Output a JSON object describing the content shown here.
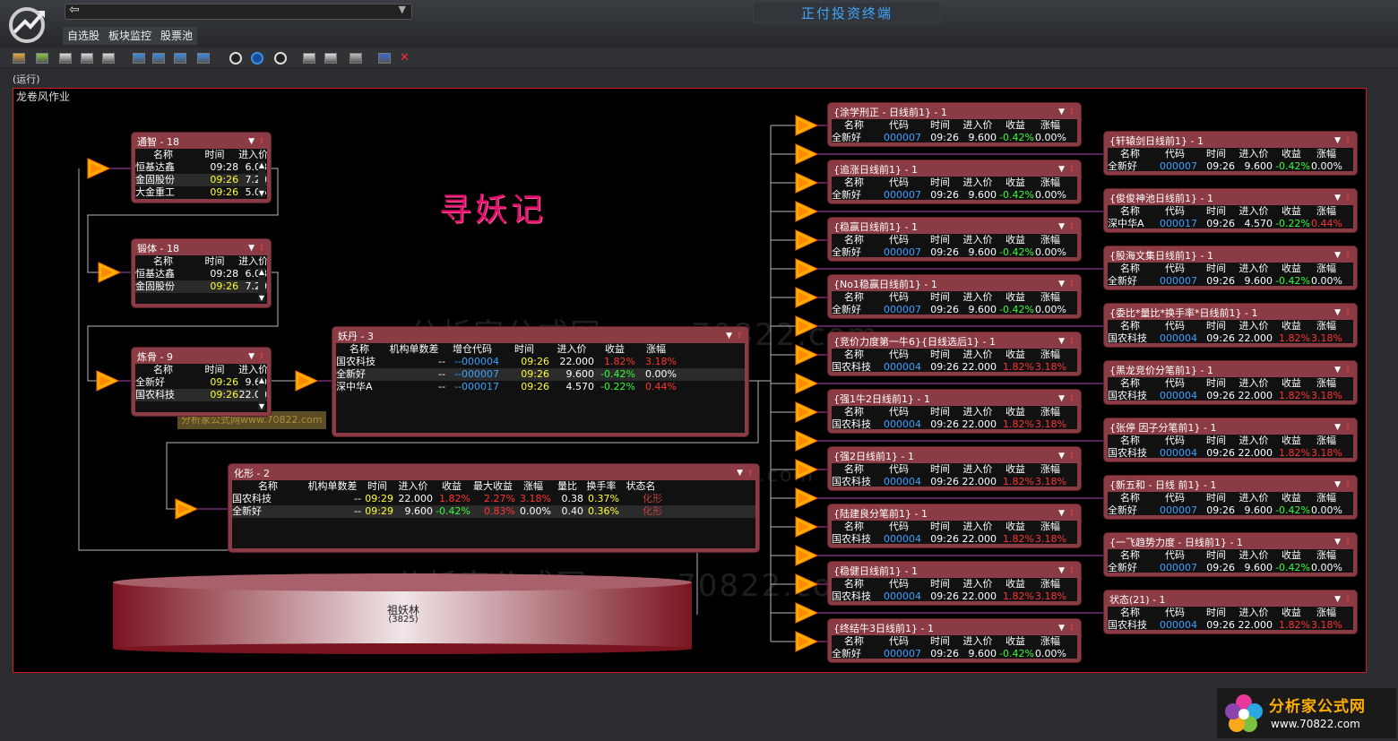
{
  "app": {
    "title": "正付投资终端",
    "address": "",
    "menu": [
      "自选股",
      "板块监控",
      "股票池"
    ],
    "status": "(运行)",
    "canvas_title": "龙卷风作业",
    "big_title": "寻妖记",
    "watermark": "分析家公式网www.70822.com",
    "brand_name": "分析家公式网",
    "brand_url": "www.70822.com",
    "pool_name": "祖妖林",
    "pool_count": "(3825)"
  },
  "toolbar": [
    "open-icon",
    "folder-icon",
    "save-icon",
    "save-as-icon",
    "copy-icon",
    "align-top-icon",
    "align-middle-icon",
    "align-bottom-icon",
    "align-h-icon",
    "run-icon",
    "pause-icon",
    "stop-icon",
    "zoom-icon",
    "zoom-fit-icon",
    "list-icon",
    "frame-icon",
    "close-icon"
  ],
  "left_nodes": [
    {
      "title": "通智 - 18",
      "cols": [
        "名称",
        "时间",
        "进入价"
      ],
      "rows": [
        [
          "恒基达鑫",
          "09:28",
          "6.08"
        ],
        [
          "金固股份",
          "09:26",
          "7.20"
        ],
        [
          "大金重工",
          "09:26",
          "5.05"
        ]
      ]
    },
    {
      "title": "锻体 - 18",
      "cols": [
        "名称",
        "时间",
        "进入价"
      ],
      "rows": [
        [
          "恒基达鑫",
          "09:28",
          "6.08"
        ],
        [
          "金固股份",
          "09:26",
          "7.20"
        ]
      ]
    },
    {
      "title": "炼骨 - 9",
      "cols": [
        "名称",
        "时间",
        "进入价"
      ],
      "rows": [
        [
          "全新好",
          "09:26",
          "9.60"
        ],
        [
          "国农科技",
          "09:26",
          "22.00"
        ]
      ]
    }
  ],
  "yaodan": {
    "title": "妖丹 - 3",
    "cols": [
      "名称",
      "机构单数差",
      "增仓代码",
      "时间",
      "进入价",
      "收益",
      "涨幅"
    ],
    "rows": [
      [
        "国农科技",
        "--",
        "--000004",
        "09:26",
        "22.000",
        "1.82%",
        "3.18%"
      ],
      [
        "全新好",
        "--",
        "--000007",
        "09:26",
        "9.600",
        "-0.42%",
        "0.00%"
      ],
      [
        "深中华A",
        "--",
        "--000017",
        "09:26",
        "4.570",
        "-0.22%",
        "0.44%"
      ]
    ]
  },
  "huaxing": {
    "title": "化形 - 2",
    "cols": [
      "名称",
      "机构单数差",
      "时间",
      "进入价",
      "收益",
      "最大收益",
      "涨幅",
      "量比",
      "换手率",
      "状态名"
    ],
    "rows": [
      [
        "国农科技",
        "--",
        "09:29",
        "22.000",
        "1.82%",
        "2.27%",
        "3.18%",
        "0.38",
        "0.37%",
        "化形"
      ],
      [
        "全新好",
        "--",
        "09:29",
        "9.600",
        "-0.42%",
        "0.83%",
        "0.00%",
        "0.40",
        "0.36%",
        "化形"
      ]
    ]
  },
  "cols": [
    "名称",
    "代码",
    "时间",
    "进入价",
    "收益",
    "涨幅"
  ],
  "s1": [
    "全新好",
    "000007",
    "09:26",
    "9.600",
    "-0.42%",
    "0.00%"
  ],
  "s4": [
    "国农科技",
    "000004",
    "09:26",
    "22.000",
    "1.82%",
    "3.18%"
  ],
  "s17": [
    "深中华A",
    "000017",
    "09:26",
    "4.570",
    "-0.22%",
    "0.44%"
  ],
  "mid_nodes": [
    {
      "title": "{涂学刑正 - 日线前1} - 1",
      "s": "s1"
    },
    {
      "title": "{追涨日线前1} - 1",
      "s": "s1"
    },
    {
      "title": "{稳赢日线前1} - 1",
      "s": "s1"
    },
    {
      "title": "{No1稳赢日线前1} - 1",
      "s": "s1"
    },
    {
      "title": "{竞价力度第一牛6}{日线选后1} - 1",
      "s": "s4"
    },
    {
      "title": "{强1牛2日线前1} - 1",
      "s": "s4"
    },
    {
      "title": "{强2日线前1} - 1",
      "s": "s4"
    },
    {
      "title": "{陆建良分笔前1} - 1",
      "s": "s4"
    },
    {
      "title": "{稳健日线前1} - 1",
      "s": "s4"
    },
    {
      "title": "{终结牛3日线前1} - 1",
      "s": "s1"
    }
  ],
  "right_nodes": [
    {
      "title": "{轩辕剑日线前1} - 1",
      "s": "s1"
    },
    {
      "title": "{俊俊神池日线前1} - 1",
      "s": "s17"
    },
    {
      "title": "{股海文集日线前1} - 1",
      "s": "s1"
    },
    {
      "title": "{委比*量比*换手率*日线前1} - 1",
      "s": "s4"
    },
    {
      "title": "{黑龙竞价分笔前1} - 1",
      "s": "s4"
    },
    {
      "title": "{张停 因子分笔前1} - 1",
      "s": "s4"
    },
    {
      "title": "{新五和 - 日线 前1} - 1",
      "s": "s1"
    },
    {
      "title": "{一飞趋势力度 - 日线前1} - 1",
      "s": "s1"
    },
    {
      "title": "状态(21) - 1",
      "s": "s4"
    }
  ]
}
